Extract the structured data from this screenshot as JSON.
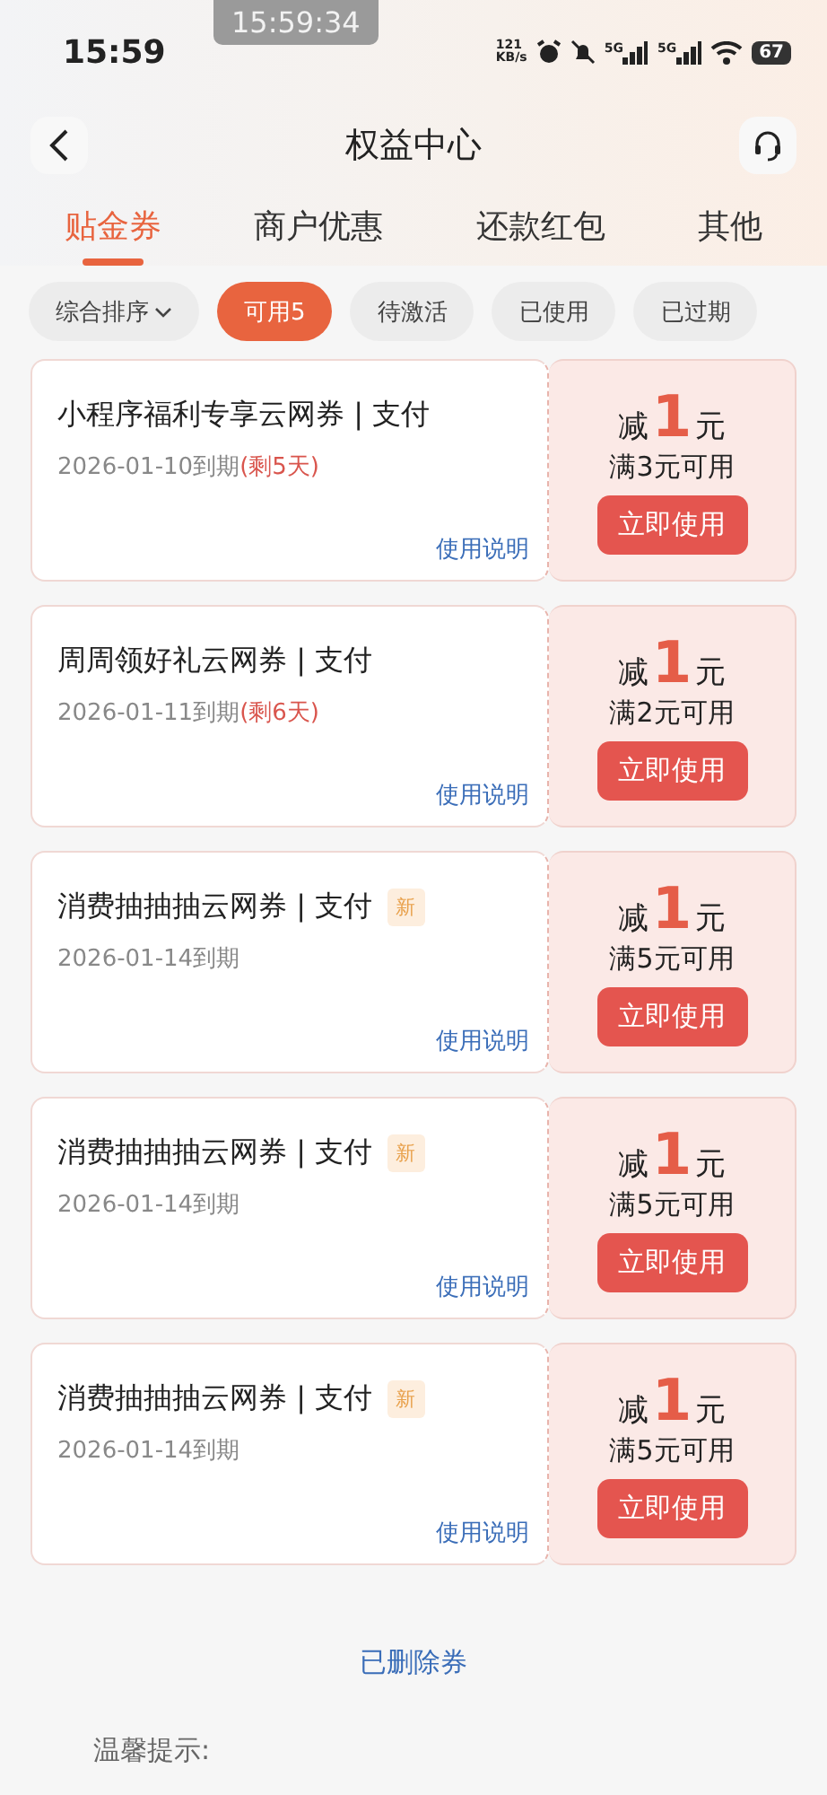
{
  "status_bar": {
    "time": "15:59",
    "recording_time": "15:59:34",
    "net_speed": "121",
    "net_unit": "KB/s",
    "sim1": "5G",
    "sim2": "5G",
    "battery": "67"
  },
  "header": {
    "title": "权益中心"
  },
  "tabs": [
    {
      "label": "贴金券",
      "selected": true
    },
    {
      "label": "商户优惠",
      "selected": false
    },
    {
      "label": "还款红包",
      "selected": false
    },
    {
      "label": "其他",
      "selected": false
    }
  ],
  "sort": {
    "label": "综合排序"
  },
  "filters": [
    {
      "label": "可用5",
      "selected": true
    },
    {
      "label": "待激活",
      "selected": false
    },
    {
      "label": "已使用",
      "selected": false
    },
    {
      "label": "已过期",
      "selected": false
    }
  ],
  "coupons": [
    {
      "title": "小程序福利专享云网券 | 支付",
      "is_new": false,
      "expiry": "2026-01-10到期",
      "remaining": "(剩5天)",
      "prefix": "减",
      "amount": "1",
      "unit": "元",
      "condition": "满3元可用",
      "button": "立即使用",
      "help": "使用说明"
    },
    {
      "title": "周周领好礼云网券 | 支付",
      "is_new": false,
      "expiry": "2026-01-11到期",
      "remaining": "(剩6天)",
      "prefix": "减",
      "amount": "1",
      "unit": "元",
      "condition": "满2元可用",
      "button": "立即使用",
      "help": "使用说明"
    },
    {
      "title": "消费抽抽抽云网券 | 支付",
      "is_new": true,
      "new_label": "新",
      "expiry": "2026-01-14到期",
      "prefix": "减",
      "amount": "1",
      "unit": "元",
      "condition": "满5元可用",
      "button": "立即使用",
      "help": "使用说明"
    },
    {
      "title": "消费抽抽抽云网券 | 支付",
      "is_new": true,
      "new_label": "新",
      "expiry": "2026-01-14到期",
      "prefix": "减",
      "amount": "1",
      "unit": "元",
      "condition": "满5元可用",
      "button": "立即使用",
      "help": "使用说明"
    },
    {
      "title": "消费抽抽抽云网券 | 支付",
      "is_new": true,
      "new_label": "新",
      "expiry": "2026-01-14到期",
      "prefix": "减",
      "amount": "1",
      "unit": "元",
      "condition": "满5元可用",
      "button": "立即使用",
      "help": "使用说明"
    }
  ],
  "deleted_link": "已删除券",
  "tips_title": "温馨提示:"
}
